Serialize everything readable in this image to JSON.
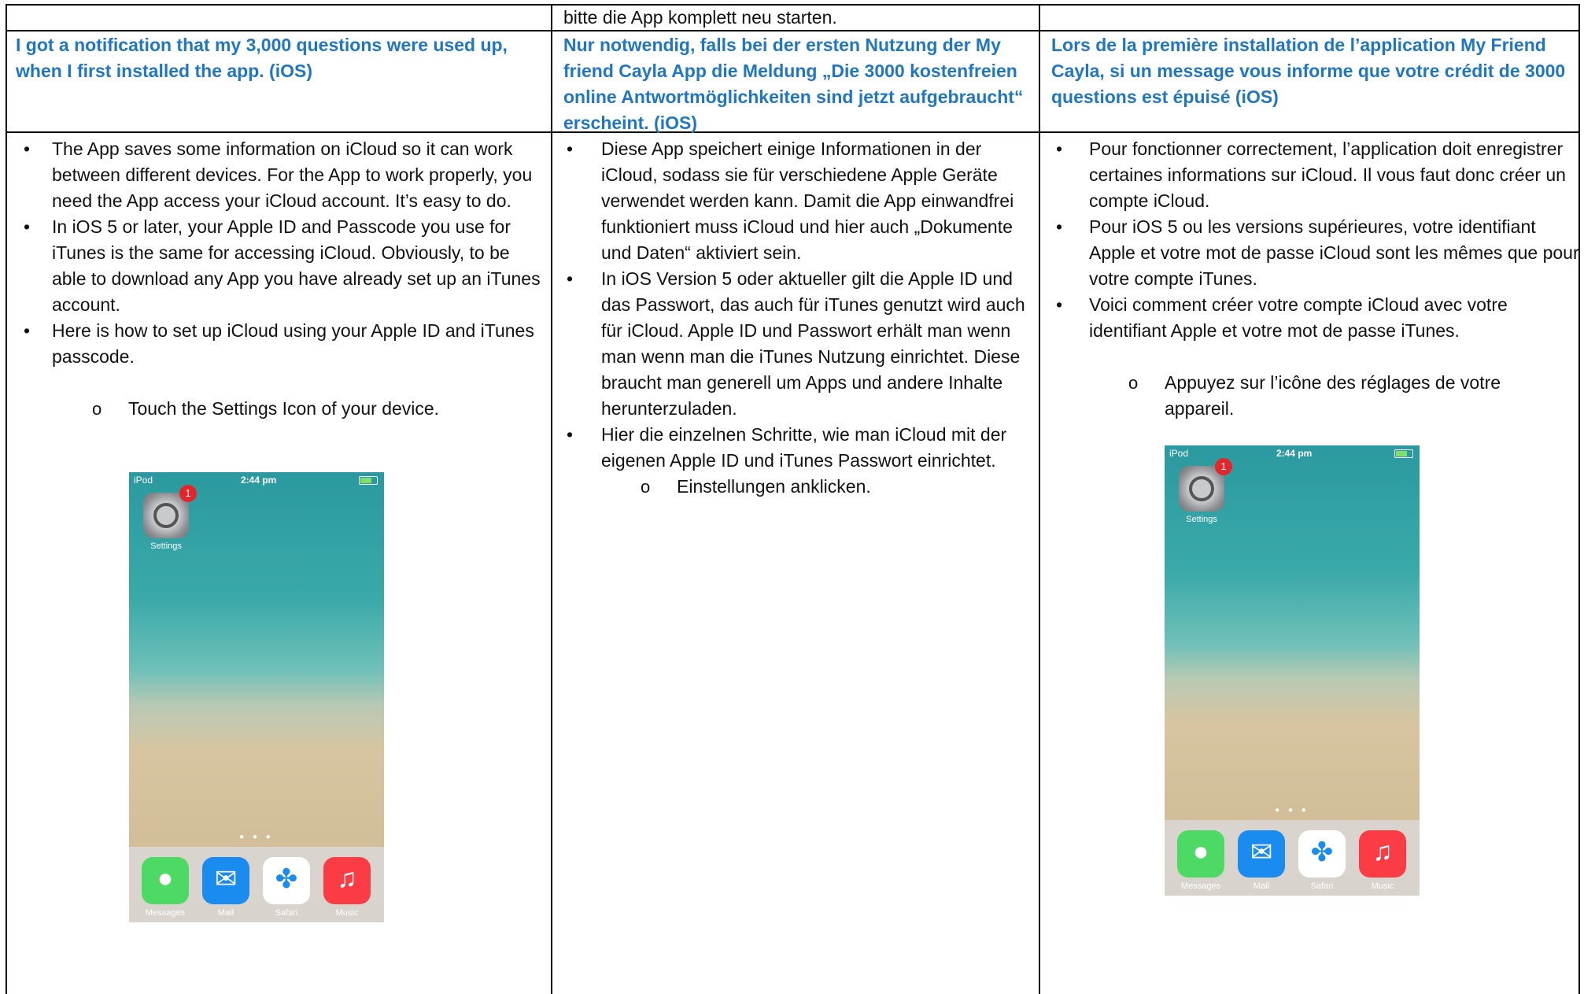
{
  "top_row": {
    "col2_text": "bitte die App komplett neu starten."
  },
  "headings": {
    "en": "I got a notification that my 3,000 questions were used up, when I first installed the app. (iOS)",
    "de": "Nur notwendig, falls bei der ersten Nutzung der My friend Cayla App die Meldung „Die 3000 kostenfreien online Antwortmöglichkeiten sind jetzt aufgebraucht“ erscheint. (iOS)",
    "fr": "Lors de la première installation de l’application My Friend Cayla, si un message vous informe que votre crédit de 3000 questions est épuisé (iOS)"
  },
  "bullet_glyph": "•",
  "sub_glyph": "o",
  "en": {
    "bullets": [
      "The App saves some information on iCloud so it can work between different devices. For the App to work properly, you need the App access your iCloud account. It’s easy to do.",
      "In iOS 5 or later, your Apple ID and Passcode you use for iTunes is the same for accessing iCloud. Obviously, to be able to download any App you have already set up an iTunes account.",
      "Here is how to set up iCloud using your Apple ID and iTunes passcode."
    ],
    "sub": "Touch the Settings Icon of your device."
  },
  "de": {
    "bullets": [
      "Diese App speichert einige Informationen in der iCloud, sodass sie für verschiedene Apple Geräte verwendet werden kann. Damit die App einwandfrei funktioniert muss iCloud und hier auch „Dokumente und Daten“ aktiviert sein.",
      "In iOS Version 5 oder aktueller gilt die Apple ID und das Passwort, das auch für iTunes genutzt wird auch für iCloud. Apple ID und Passwort erhält man wenn man wenn man die iTunes Nutzung einrichtet. Diese braucht man generell um Apps und andere Inhalte herunterzuladen.",
      "Hier die einzelnen Schritte, wie man iCloud mit der eigenen Apple ID und iTunes Passwort einrichtet."
    ],
    "sub": "Einstellungen anklicken."
  },
  "fr": {
    "bullets": [
      "Pour fonctionner correctement, l’application doit enregistrer certaines informations sur iCloud. Il vous faut donc créer un compte iCloud.",
      "Pour iOS 5 ou les versions supérieures, votre identifiant Apple et votre mot de passe iCloud sont les mêmes que pour votre compte iTunes.",
      "Voici comment créer votre compte iCloud avec votre identifiant Apple et votre mot de passe iTunes."
    ],
    "sub": "Appuyez sur l’icône des réglages de votre appareil."
  },
  "phone": {
    "carrier": "iPod",
    "time": "2:44 pm",
    "badge": "1",
    "settings_label": "Settings",
    "dock_labels": [
      "Messages",
      "Mail",
      "Safari",
      "Music"
    ],
    "colors": {
      "sea": "#2b9aa0",
      "sand": "#d8c4a0",
      "messages": "#4cd964",
      "mail": "#1a8cf0",
      "safari": "#ffffff",
      "music": "#fc3c44"
    }
  }
}
